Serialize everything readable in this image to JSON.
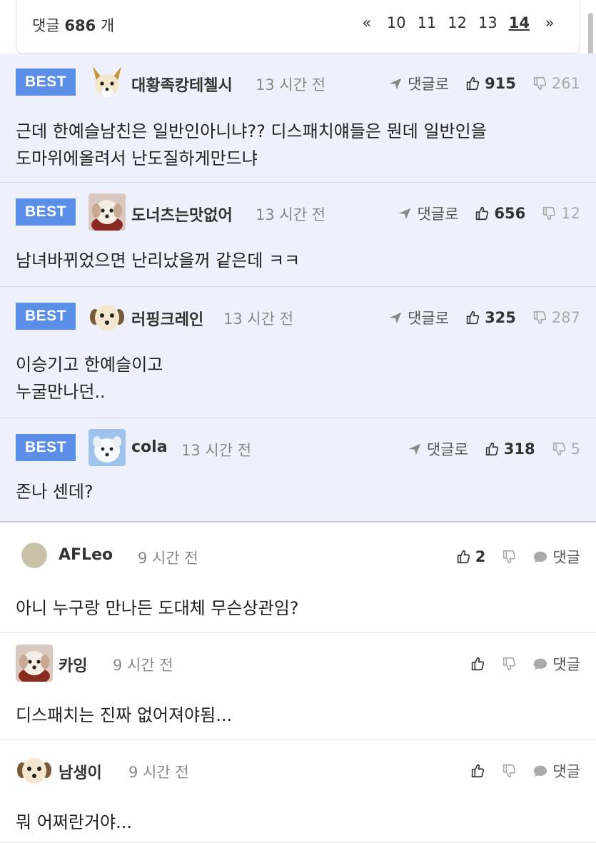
{
  "header": {
    "count_label": "댓글",
    "count": "686",
    "count_unit": "개",
    "pager": {
      "first": "«",
      "pages": [
        "10",
        "11",
        "12",
        "13",
        "14"
      ],
      "current": "14",
      "last": "»"
    }
  },
  "labels": {
    "best": "BEST",
    "reply": "댓글로",
    "reply_short": "댓글"
  },
  "best_comments": [
    {
      "nick": "대황족캉테첼시",
      "time": "13 시간 전",
      "likes": "915",
      "dislikes": "261",
      "lines": [
        "근데 한예슬남친은 일반인아니냐?? 디스패치얘들은 뭔데 일반인을",
        "도마위에올려서 난도질하게만드냐"
      ]
    },
    {
      "nick": "도너츠는맛없어",
      "time": "13 시간 전",
      "likes": "656",
      "dislikes": "12",
      "lines": [
        "남녀바뀌었으면 난리났을꺼 같은데 ㅋㅋ"
      ]
    },
    {
      "nick": "러핑크레인",
      "time": "13 시간 전",
      "likes": "325",
      "dislikes": "287",
      "lines": [
        "이승기고 한예슬이고",
        "누굴만나던.."
      ]
    },
    {
      "nick": "cola",
      "time": "13 시간 전",
      "likes": "318",
      "dislikes": "5",
      "lines": [
        "존나 센데?"
      ]
    }
  ],
  "comments": [
    {
      "nick": "AFLeo",
      "time": "9 시간 전",
      "likes": "2",
      "text": "아니 누구랑 만나든 도대체 무슨상관임?"
    },
    {
      "nick": "카잉",
      "time": "9 시간 전",
      "likes": "",
      "text": "디스패치는 진짜 없어져야됨..."
    },
    {
      "nick": "남생이",
      "time": "9 시간 전",
      "likes": "",
      "text": "뭐 어쩌란거야..."
    }
  ],
  "colors": {
    "best_badge": "#5b8ee6",
    "best_bg": "#eef1fb"
  },
  "icons": [
    "send-arrow-icon",
    "thumbs-up-icon",
    "thumbs-down-icon",
    "speech-bubble-icon"
  ]
}
